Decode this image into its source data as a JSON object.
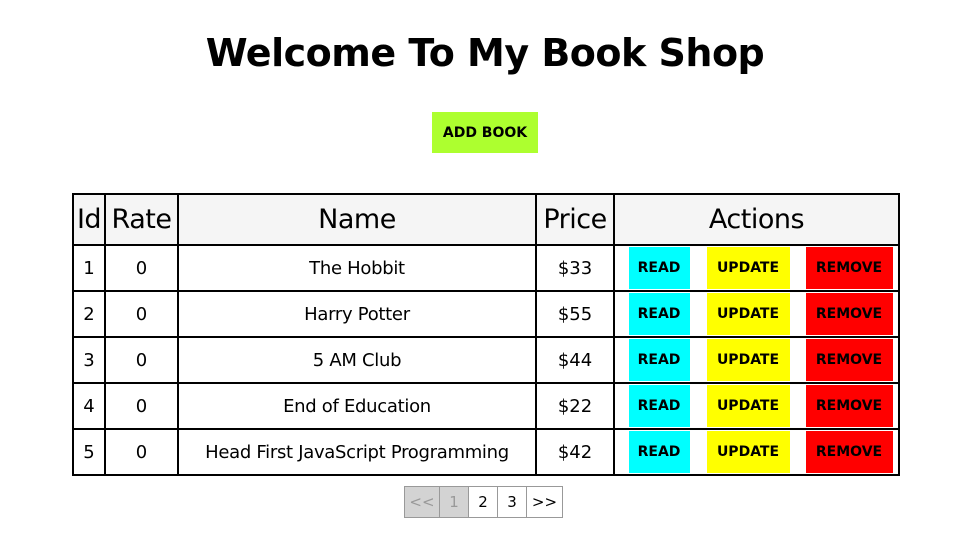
{
  "header": {
    "title": "Welcome To My Book Shop",
    "add_book_label": "ADD BOOK"
  },
  "table": {
    "columns": [
      "Id",
      "Rate",
      "Name",
      "Price",
      "Actions"
    ],
    "rows": [
      {
        "id": "1",
        "rate": "0",
        "name": "The Hobbit",
        "price": "$33"
      },
      {
        "id": "2",
        "rate": "0",
        "name": "Harry Potter",
        "price": "$55"
      },
      {
        "id": "3",
        "rate": "0",
        "name": "5 AM Club",
        "price": "$44"
      },
      {
        "id": "4",
        "rate": "0",
        "name": "End of Education",
        "price": "$22"
      },
      {
        "id": "5",
        "rate": "0",
        "name": "Head First JavaScript Programming",
        "price": "$42"
      }
    ],
    "actions": {
      "read_label": "READ",
      "update_label": "UPDATE",
      "remove_label": "REMOVE"
    }
  },
  "pagination": {
    "first_label": "<<",
    "pages": [
      "1",
      "2",
      "3"
    ],
    "current_page": "1",
    "next_label": ">>"
  },
  "colors": {
    "add_book": "#adff2f",
    "read": "#00ffff",
    "update": "#ffff00",
    "remove": "#ff0000",
    "header_bg": "#f5f5f5"
  }
}
